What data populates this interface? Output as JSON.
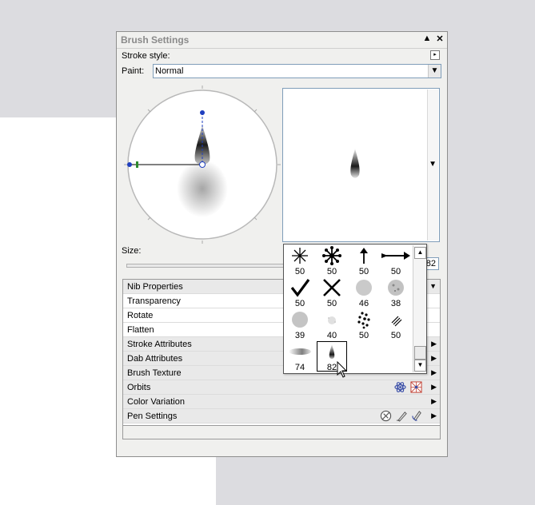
{
  "window": {
    "title": "Brush Settings",
    "minimize_icon": "triangle-up-icon",
    "close_icon": "close-icon"
  },
  "stroke": {
    "label": "Stroke style:"
  },
  "paint": {
    "label": "Paint:",
    "value": "Normal"
  },
  "size": {
    "label": "Size:",
    "value": "82"
  },
  "properties": [
    {
      "label": "Nib Properties",
      "header": true,
      "expanded": true
    },
    {
      "label": "Transparency",
      "header": false
    },
    {
      "label": "Rotate",
      "header": false
    },
    {
      "label": "Flatten",
      "header": false
    },
    {
      "label": "Stroke Attributes",
      "header": true
    },
    {
      "label": "Dab Attributes",
      "header": true
    },
    {
      "label": "Brush Texture",
      "header": true
    },
    {
      "label": "Orbits",
      "header": true
    },
    {
      "label": "Color Variation",
      "header": true
    },
    {
      "label": "Pen Settings",
      "header": true
    }
  ],
  "nib_popup": {
    "items": [
      {
        "icon": "star-burst-nib-icon",
        "size": "50"
      },
      {
        "icon": "snowflake-nib-icon",
        "size": "50"
      },
      {
        "icon": "arrow-up-nib-icon",
        "size": "50"
      },
      {
        "icon": "arrow-right-nib-icon",
        "size": "50"
      },
      {
        "icon": "checkmark-nib-icon",
        "size": "50"
      },
      {
        "icon": "x-nib-icon",
        "size": "50"
      },
      {
        "icon": "soft-round-nib-icon",
        "size": "46"
      },
      {
        "icon": "speckle-round-nib-icon",
        "size": "38"
      },
      {
        "icon": "texture-round-nib-icon",
        "size": "39"
      },
      {
        "icon": "faint-dots-nib-icon",
        "size": "40"
      },
      {
        "icon": "dot-cluster-nib-icon",
        "size": "50"
      },
      {
        "icon": "slash-lines-nib-icon",
        "size": "50"
      },
      {
        "icon": "smudge-nib-icon",
        "size": "74"
      },
      {
        "icon": "pointed-nib-icon",
        "size": "82",
        "selected": true
      }
    ]
  },
  "colors": {
    "panel_bg": "#f0f0ee",
    "field_border": "#7f9db9",
    "dial_handle": "#1f3fbf",
    "dial_marker": "#2e8b2e"
  }
}
